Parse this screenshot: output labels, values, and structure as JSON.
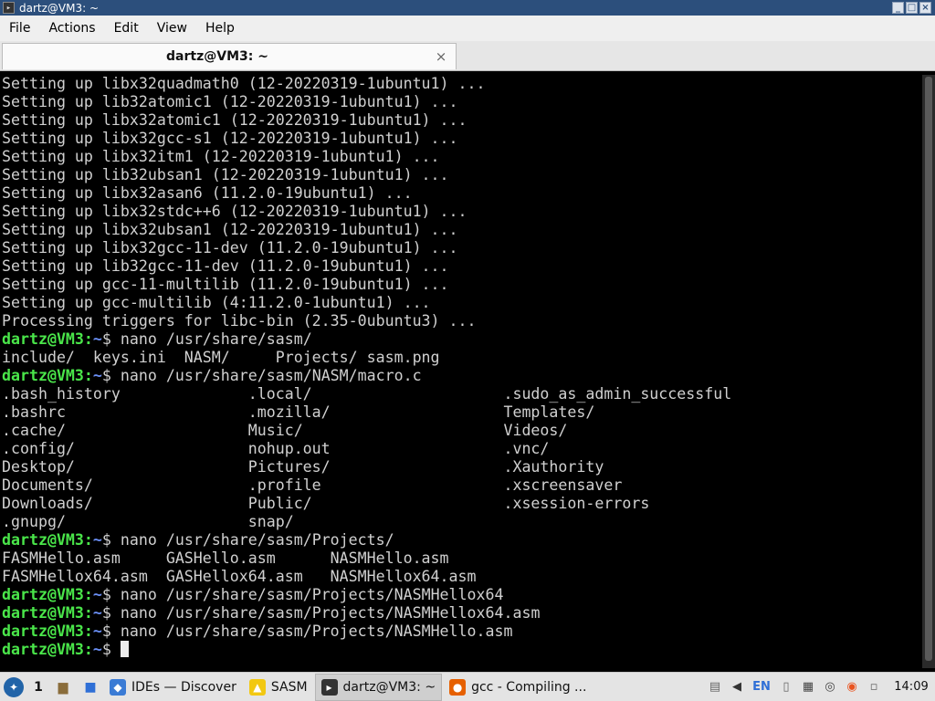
{
  "window": {
    "title": "dartz@VM3: ~"
  },
  "menu": [
    "File",
    "Actions",
    "Edit",
    "View",
    "Help"
  ],
  "tab": {
    "label": "dartz@VM3: ~",
    "close": "×"
  },
  "terminal": {
    "lines": [
      {
        "text": "Setting up libx32quadmath0 (12-20220319-1ubuntu1) ..."
      },
      {
        "text": "Setting up lib32atomic1 (12-20220319-1ubuntu1) ..."
      },
      {
        "text": "Setting up libx32atomic1 (12-20220319-1ubuntu1) ..."
      },
      {
        "text": "Setting up libx32gcc-s1 (12-20220319-1ubuntu1) ..."
      },
      {
        "text": "Setting up libx32itm1 (12-20220319-1ubuntu1) ..."
      },
      {
        "text": "Setting up lib32ubsan1 (12-20220319-1ubuntu1) ..."
      },
      {
        "text": "Setting up libx32asan6 (11.2.0-19ubuntu1) ..."
      },
      {
        "text": "Setting up libx32stdc++6 (12-20220319-1ubuntu1) ..."
      },
      {
        "text": "Setting up libx32ubsan1 (12-20220319-1ubuntu1) ..."
      },
      {
        "text": "Setting up libx32gcc-11-dev (11.2.0-19ubuntu1) ..."
      },
      {
        "text": "Setting up lib32gcc-11-dev (11.2.0-19ubuntu1) ..."
      },
      {
        "text": "Setting up gcc-11-multilib (11.2.0-19ubuntu1) ..."
      },
      {
        "text": "Setting up gcc-multilib (4:11.2.0-1ubuntu1) ..."
      },
      {
        "text": "Processing triggers for libc-bin (2.35-0ubuntu3) ..."
      },
      {
        "prompt": "dartz@VM3",
        "path": "~",
        "text": "$ nano /usr/share/sasm/"
      },
      {
        "text": "include/  keys.ini  NASM/     Projects/ sasm.png"
      },
      {
        "prompt": "dartz@VM3",
        "path": "~",
        "text": "$ nano /usr/share/sasm/NASM/macro.c"
      },
      {
        "text": ".bash_history              .local/                     .sudo_as_admin_successful"
      },
      {
        "text": ".bashrc                    .mozilla/                   Templates/"
      },
      {
        "text": ".cache/                    Music/                      Videos/"
      },
      {
        "text": ".config/                   nohup.out                   .vnc/"
      },
      {
        "text": "Desktop/                   Pictures/                   .Xauthority"
      },
      {
        "text": "Documents/                 .profile                    .xscreensaver"
      },
      {
        "text": "Downloads/                 Public/                     .xsession-errors"
      },
      {
        "text": ".gnupg/                    snap/"
      },
      {
        "prompt": "dartz@VM3",
        "path": "~",
        "text": "$ nano /usr/share/sasm/Projects/"
      },
      {
        "text": "FASMHello.asm     GASHello.asm      NASMHello.asm"
      },
      {
        "text": "FASMHellox64.asm  GASHellox64.asm   NASMHellox64.asm"
      },
      {
        "prompt": "dartz@VM3",
        "path": "~",
        "text": "$ nano /usr/share/sasm/Projects/NASMHellox64"
      },
      {
        "prompt": "dartz@VM3",
        "path": "~",
        "text": "$ nano /usr/share/sasm/Projects/NASMHellox64.asm"
      },
      {
        "prompt": "dartz@VM3",
        "path": "~",
        "text": "$ nano /usr/share/sasm/Projects/NASMHello.asm"
      },
      {
        "prompt": "dartz@VM3",
        "path": "~",
        "text": "$ ",
        "cursor": true
      }
    ]
  },
  "taskbar": {
    "desktop_number": "1",
    "tasks": [
      {
        "name": "task-discover",
        "label": "IDEs — Discover",
        "icon": "discover-icon",
        "icon_color": "#3a7bd5"
      },
      {
        "name": "task-sasm",
        "label": "SASM",
        "icon": "sasm-icon",
        "icon_color": "#f2c811"
      },
      {
        "name": "task-terminal",
        "label": "dartz@VM3: ~",
        "icon": "terminal-icon",
        "icon_color": "#333333",
        "active": true
      },
      {
        "name": "task-firefox",
        "label": "gcc - Compiling ...",
        "icon": "firefox-icon",
        "icon_color": "#e66000"
      }
    ],
    "language": "EN",
    "clock": "14:09"
  }
}
